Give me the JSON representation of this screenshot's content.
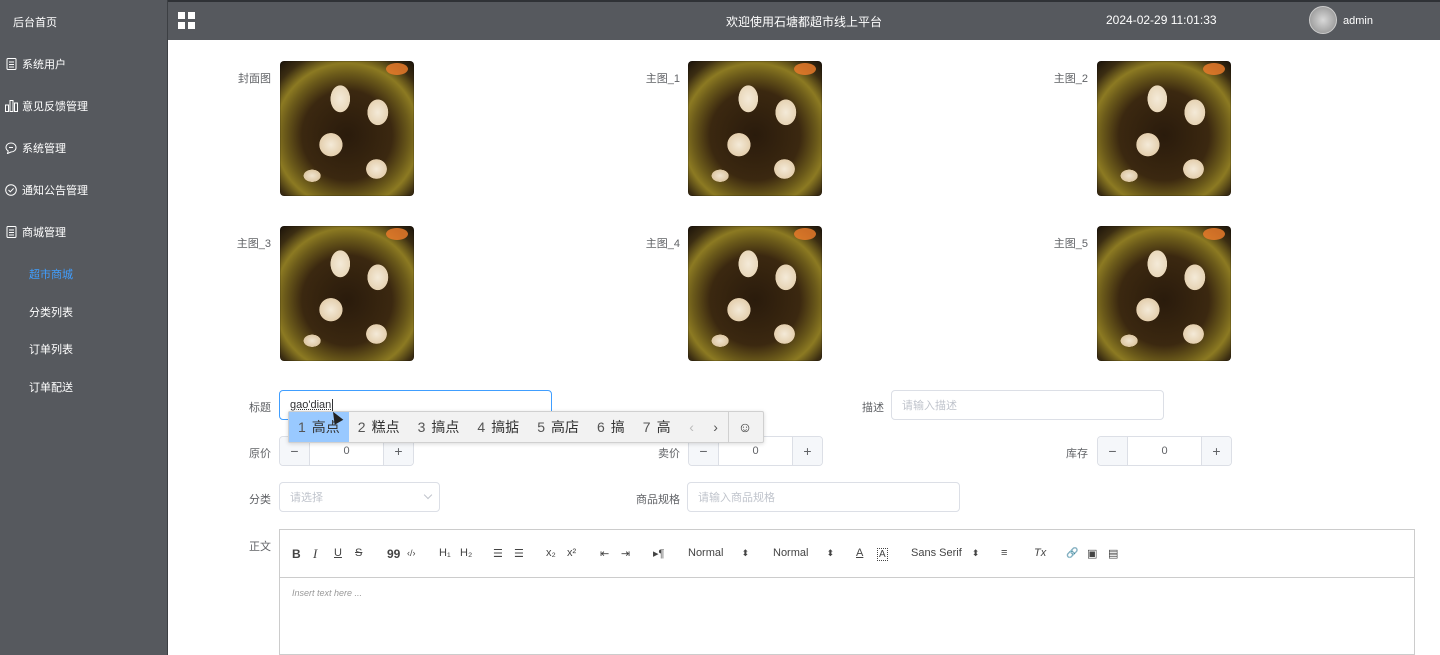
{
  "sidebar": {
    "home": "后台首页",
    "items": [
      {
        "label": "系统用户",
        "icon": "document-icon"
      },
      {
        "label": "意见反馈管理",
        "icon": "bar-chart-icon"
      },
      {
        "label": "系统管理",
        "icon": "chat-icon"
      },
      {
        "label": "通知公告管理",
        "icon": "check-circle-icon"
      },
      {
        "label": "商城管理",
        "icon": "document-icon"
      }
    ],
    "subitems": [
      {
        "label": "超市商城",
        "active": true
      },
      {
        "label": "分类列表"
      },
      {
        "label": "订单列表"
      },
      {
        "label": "订单配送"
      }
    ]
  },
  "header": {
    "title": "欢迎使用石塘都超市线上平台",
    "datetime": "2024-02-29 11:01:33",
    "user": "admin"
  },
  "form": {
    "images": [
      {
        "label": "封面图"
      },
      {
        "label": "主图_1"
      },
      {
        "label": "主图_2"
      },
      {
        "label": "主图_3"
      },
      {
        "label": "主图_4"
      },
      {
        "label": "主图_5"
      }
    ],
    "title_label": "标题",
    "title_value": "gao'dian",
    "desc_label": "描述",
    "desc_placeholder": "请输入描述",
    "orig_price_label": "原价",
    "orig_price": "0",
    "sale_price_label": "卖价",
    "sale_price": "0",
    "stock_label": "库存",
    "stock": "0",
    "category_label": "分类",
    "category_placeholder": "请选择",
    "spec_label": "商品规格",
    "spec_placeholder": "请输入商品规格",
    "body_label": "正文"
  },
  "ime": {
    "candidates": [
      {
        "num": "1",
        "text": "高点"
      },
      {
        "num": "2",
        "text": "糕点"
      },
      {
        "num": "3",
        "text": "搞点"
      },
      {
        "num": "4",
        "text": "搞掂"
      },
      {
        "num": "5",
        "text": "高店"
      },
      {
        "num": "6",
        "text": "搞"
      },
      {
        "num": "7",
        "text": "高"
      }
    ],
    "prev": "‹",
    "next": "›",
    "emoji": "☺"
  },
  "editor": {
    "bold": "B",
    "italic": "I",
    "underline": "U",
    "strike": "S",
    "quote": "99",
    "code": "‹/›",
    "h1": "H₁",
    "h2": "H₂",
    "ol": "☰",
    "ul": "☰",
    "sub": "x₂",
    "sup": "x²",
    "outdent": "⇤",
    "indent": "⇥",
    "direction": "▸¶",
    "size": "Normal",
    "header": "Normal",
    "font_color": "A",
    "bg_color": "A",
    "font": "Sans Serif",
    "align": "≡",
    "clean": "Tx",
    "link": "🔗",
    "image": "▣",
    "video": "▤",
    "placeholder": "Insert text here ..."
  }
}
